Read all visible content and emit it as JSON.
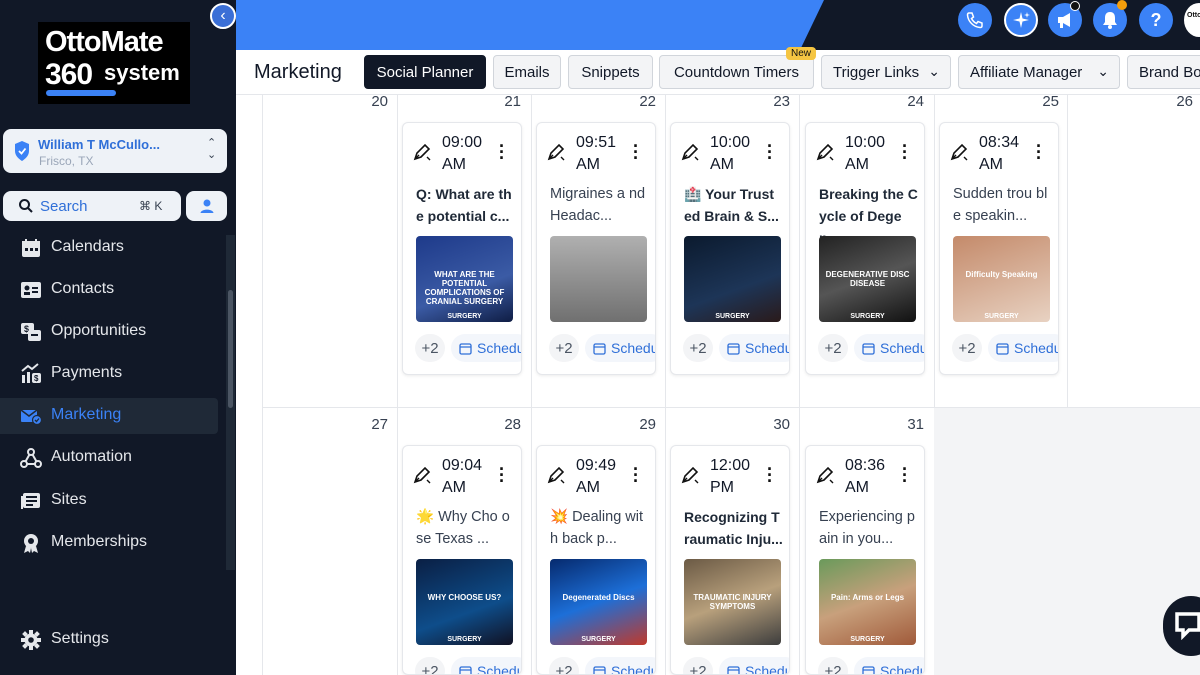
{
  "logo": {
    "line1": "OttoMate",
    "line2": "360",
    "line3": "system"
  },
  "location": {
    "name": "William T McCullo...",
    "city": "Frisco, TX"
  },
  "search": {
    "label": "Search",
    "shortcut": "⌘ K"
  },
  "nav": [
    {
      "label": "Calendars",
      "icon": "calendar-icon"
    },
    {
      "label": "Contacts",
      "icon": "contacts-icon"
    },
    {
      "label": "Opportunities",
      "icon": "opportunities-icon"
    },
    {
      "label": "Payments",
      "icon": "payments-icon"
    },
    {
      "label": "Marketing",
      "icon": "marketing-icon",
      "active": true
    },
    {
      "label": "Automation",
      "icon": "automation-icon"
    },
    {
      "label": "Sites",
      "icon": "sites-icon"
    },
    {
      "label": "Memberships",
      "icon": "memberships-icon"
    }
  ],
  "settings": {
    "label": "Settings"
  },
  "header": {
    "title": "Marketing",
    "tabs": [
      "Social Planner",
      "Emails",
      "Snippets",
      "Countdown Timers",
      "Trigger Links",
      "Affiliate Manager",
      "Brand Bo"
    ],
    "new_badge": "New",
    "help": "?"
  },
  "calendar": {
    "week1_days": [
      "20",
      "21",
      "22",
      "23",
      "24",
      "25",
      "26"
    ],
    "week2_days": [
      "27",
      "28",
      "29",
      "30",
      "31"
    ],
    "week1_posts": [
      {
        "time": "09:00",
        "ampm": "AM",
        "text": "Q: What are th e potential c...",
        "bold": true,
        "more": "+2",
        "status": "Schedu",
        "thumb_text": "WHAT ARE THE POTENTIAL COMPLICATIONS OF CRANIAL SURGERY",
        "thumb_footer": "SURGERY"
      },
      {
        "time": "09:51",
        "ampm": "AM",
        "text": "Migraines a nd Headac...",
        "bold": false,
        "more": "+2",
        "status": "Schedu",
        "thumb_text": "",
        "thumb_footer": ""
      },
      {
        "time": "10:00",
        "ampm": "AM",
        "text": "🏥 Your Trust ed Brain & S...",
        "bold": true,
        "more": "+2",
        "status": "Schedu",
        "thumb_text": "",
        "thumb_footer": "SURGERY"
      },
      {
        "time": "10:00",
        "ampm": "AM",
        "text": "Breaking the C ycle of Degen...",
        "bold": true,
        "more": "+2",
        "status": "Schedu",
        "thumb_text": "DEGENERATIVE DISC DISEASE",
        "thumb_footer": "SURGERY"
      },
      {
        "time": "08:34",
        "ampm": "AM",
        "text": "Sudden trou ble speakin...",
        "bold": false,
        "more": "+2",
        "status": "Schedu",
        "thumb_text": "Difficulty Speaking",
        "thumb_footer": "SURGERY"
      }
    ],
    "week2_posts": [
      {
        "time": "09:04",
        "ampm": "AM",
        "text": "🌟 Why Cho ose Texas ...",
        "bold": false,
        "more": "+2",
        "status": "Schedu",
        "thumb_text": "WHY CHOOSE US?",
        "thumb_footer": "SURGERY"
      },
      {
        "time": "09:49",
        "ampm": "AM",
        "text": "💥 Dealing with back p...",
        "bold": false,
        "more": "+2",
        "status": "Schedu",
        "thumb_text": "Degenerated Discs",
        "thumb_footer": "SURGERY"
      },
      {
        "time": "12:00",
        "ampm": "PM",
        "text": "Recognizing T raumatic Inju...",
        "bold": true,
        "more": "+2",
        "status": "Schedu",
        "thumb_text": "TRAUMATIC INJURY SYMPTOMS",
        "thumb_footer": ""
      },
      {
        "time": "08:36",
        "ampm": "AM",
        "text": "Experiencing pain in you...",
        "bold": false,
        "more": "+2",
        "status": "Schedu",
        "thumb_text": "Pain: Arms or Legs",
        "thumb_footer": "SURGERY"
      }
    ]
  },
  "colors": {
    "accent": "#3b82f6",
    "sidebar": "#111827",
    "link": "#2f6fd8"
  }
}
